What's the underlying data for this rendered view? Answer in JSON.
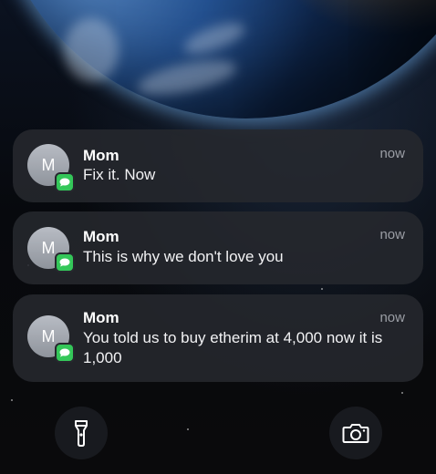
{
  "notifications": [
    {
      "avatar_initial": "M",
      "sender": "Mom",
      "time": "now",
      "message": "Fix it. Now",
      "app_icon": "messages-icon"
    },
    {
      "avatar_initial": "M",
      "sender": "Mom",
      "time": "now",
      "message": "This is why we don't love you",
      "app_icon": "messages-icon"
    },
    {
      "avatar_initial": "M",
      "sender": "Mom",
      "time": "now",
      "message": "You told us to buy etherim at 4,000 now it is 1,000",
      "app_icon": "messages-icon"
    }
  ],
  "quick_actions": {
    "left_icon": "flashlight-icon",
    "right_icon": "camera-icon"
  },
  "colors": {
    "messages_badge": "#34c759",
    "notification_bg": "#26282e"
  }
}
